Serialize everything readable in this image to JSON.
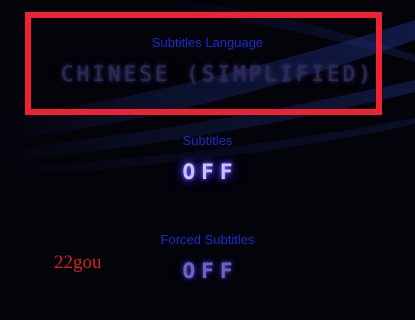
{
  "settings": {
    "subtitles_language": {
      "label": "Subtitles Language",
      "value": "CHINESE (SIMPLIFIED)"
    },
    "subtitles": {
      "label": "Subtitles",
      "value": "OFF"
    },
    "forced_subtitles": {
      "label": "Forced Subtitles",
      "value": "OFF"
    }
  },
  "watermark": {
    "text": "22gou"
  },
  "colors": {
    "label": "#1a2ad0",
    "highlight": "#ee2233",
    "watermark": "#d42020",
    "streak": "#1b2a6a"
  }
}
